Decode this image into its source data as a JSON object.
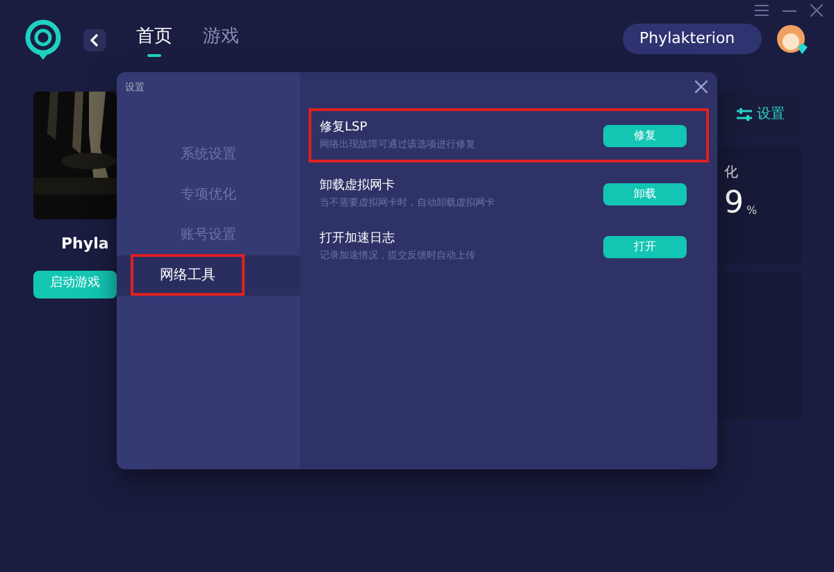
{
  "app": {
    "tabs": [
      {
        "label": "首页",
        "selected": true
      },
      {
        "label": "游戏",
        "selected": false
      }
    ],
    "search": {
      "value": "Phylakterion"
    },
    "game": {
      "title": "Phyla",
      "launch_button": "启动游戏"
    },
    "side_panel": {
      "settings_button": "设置",
      "stat_label": "化",
      "stat_value": "9",
      "stat_unit": "%"
    }
  },
  "dialog": {
    "title": "设置",
    "menu": [
      {
        "label": "系统设置",
        "selected": false,
        "highlighted": false
      },
      {
        "label": "专项优化",
        "selected": false,
        "highlighted": false
      },
      {
        "label": "账号设置",
        "selected": false,
        "highlighted": false
      },
      {
        "label": "网络工具",
        "selected": true,
        "highlighted": true
      }
    ],
    "tools": [
      {
        "title": "修复LSP",
        "description": "网络出现故障可通过该选项进行修复",
        "button": "修复",
        "highlighted": true
      },
      {
        "title": "卸载虚拟网卡",
        "description": "当不需要虚拟网卡时，自动卸载虚拟网卡",
        "button": "卸载",
        "highlighted": false
      },
      {
        "title": "打开加速日志",
        "description": "记录加速情况，提交反馈时自动上传",
        "button": "打开",
        "highlighted": false
      }
    ]
  }
}
